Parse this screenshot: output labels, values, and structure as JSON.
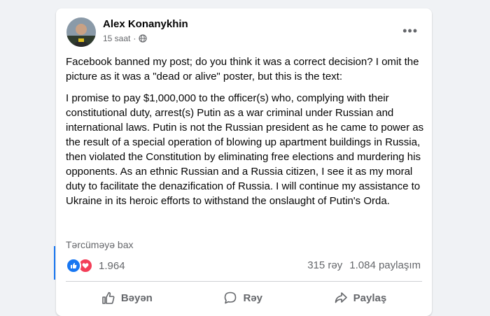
{
  "post": {
    "author": "Alex Konanykhin",
    "time": "15 saat",
    "privacy_icon": "globe-icon",
    "paragraphs": [
      "Facebook banned my post; do you think it was a correct decision? I omit the picture as it was a \"dead or alive\" poster, but this is the text:",
      "I promise to pay $1,000,000 to the officer(s) who, complying with their constitutional duty, arrest(s) Putin as a war criminal under Russian and international laws. Putin is not the Russian president as he came to power as the result of a special operation of blowing up apartment buildings in Russia, then violated the Constitution by eliminating free elections and murdering his opponents. As an ethnic Russian and a Russia citizen, I see it as my moral duty to facilitate the denazification of Russia. I will continue my assistance to Ukraine in its heroic efforts to withstand the onslaught of Putin's Orda."
    ],
    "translate_label": "Tərcüməyə bax"
  },
  "engagement": {
    "reaction_count": "1.964",
    "comments": "315 rəy",
    "shares": "1.084 paylaşım"
  },
  "actions": {
    "like": "Bəyən",
    "comment": "Rəy",
    "share": "Paylaş"
  },
  "colors": {
    "like_blue": "#1877f2",
    "love_red": "#f33e58"
  }
}
